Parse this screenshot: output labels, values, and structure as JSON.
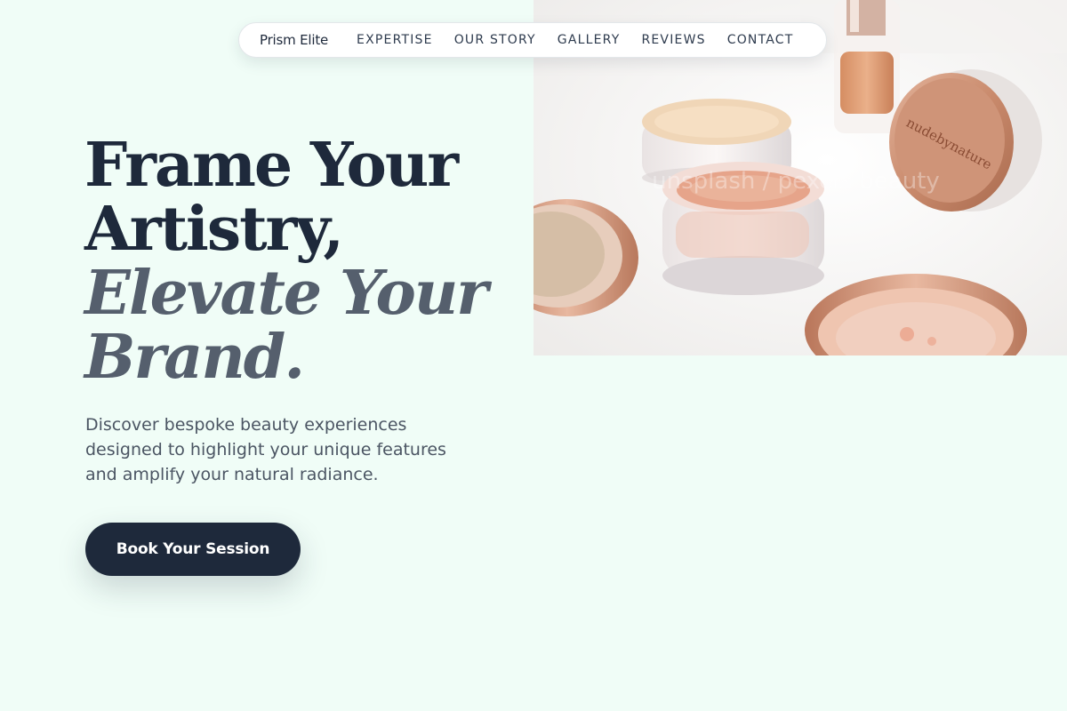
{
  "nav": {
    "brand": "Prism Elite",
    "links": [
      "EXPERTISE",
      "OUR STORY",
      "GALLERY",
      "REVIEWS",
      "CONTACT"
    ]
  },
  "hero": {
    "headline_line_1": "Frame Your",
    "headline_line_2": "Artistry,",
    "headline_line_3": "Elevate Your",
    "headline_line_4": "Brand.",
    "description": "Discover bespoke beauty experiences designed to highlight your unique features and amplify your natural radiance.",
    "cta_label": "Book Your Session",
    "image_jar_label": "nudebynature",
    "image_watermark": "unsplash / pexels beauty"
  },
  "colors": {
    "background": "#f0fdf7",
    "primary": "#1e293b",
    "muted_heading": "#555f6d",
    "body_text": "#4b5563"
  }
}
